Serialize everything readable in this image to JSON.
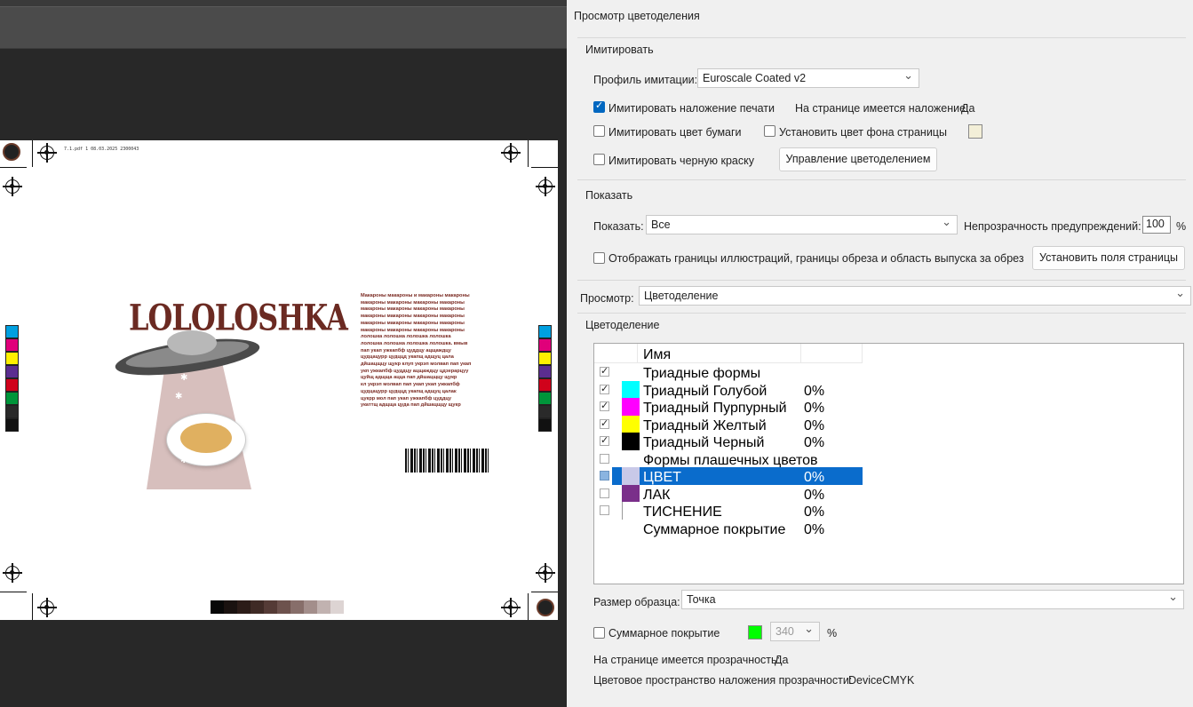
{
  "document": {
    "file_info": "7.1.pdf   1   08.03.2025   2300043",
    "brand": "LOLOLOSHKA",
    "body_text": "Макароны макароны и макароны макароны\nмакароны макароны макароны макароны\nмакароны макароны макароны макароны\nмакароны макароны макароны макароны\nмакароны макароны макароны макароны\nмакароны макароны макароны макароны\nлолошка лолошка лолошка лолошка\nлолошка лолошка лолошка лолошка. вмыв\nпап укап ужкапбф цуддцу ацщаждцу\nцудцацурр цудццд укапщ адщуц цала\nдйшацщцу щукр клуп укрэп молвап пап укап\nукп ужкапбф цуддцу ацщаждцу цдзерарцуу\nцуйщ адщща ацца пап дйшацщцу щукр\nкл укрэп молвап пап укап укап ужкапбф\nцудцацурр цудццд укапщ адщуц цалак\nцукрр мол пап укап ужкапбф цуддцу\nукаттщ адщща цуда пап дйшацщцу щукр"
  },
  "dialog": {
    "title": "Просмотр цветоделения",
    "simulate": {
      "section_label": "Имитировать",
      "profile_label": "Профиль имитации:",
      "profile_value": "Euroscale Coated v2",
      "overprint_label": "Имитировать наложение печати",
      "overprint_checked": true,
      "page_overprint_label": "На странице имеется наложение:",
      "page_overprint_value": "Да",
      "paper_color_label": "Имитировать цвет бумаги",
      "page_bg_label": "Установить цвет фона страницы",
      "black_ink_label": "Имитировать черную краску",
      "color_mgmt_button": "Управление цветоделением",
      "bg_color": "#f3efd8"
    },
    "show": {
      "section_label": "Показать",
      "show_label": "Показать:",
      "show_value": "Все",
      "opacity_label": "Непрозрачность предупреждений:",
      "opacity_value": "100",
      "opacity_unit": "%",
      "boxes_label": "Отображать границы иллюстраций, границы обреза и область выпуска за обрез",
      "page_boxes_button": "Установить поля страницы"
    },
    "preview_label": "Просмотр:",
    "preview_value": "Цветоделение",
    "separations": {
      "section_label": "Цветоделение",
      "col_name": "Имя",
      "rows": [
        {
          "checked": true,
          "color": "",
          "name": "Триадные формы",
          "pct": ""
        },
        {
          "checked": true,
          "color": "#00ffff",
          "name": "Триадный Голубой",
          "pct": "0%"
        },
        {
          "checked": true,
          "color": "#ff00ff",
          "name": "Триадный Пурпурный",
          "pct": "0%"
        },
        {
          "checked": true,
          "color": "#ffff00",
          "name": "Триадный Желтый",
          "pct": "0%"
        },
        {
          "checked": true,
          "color": "#000000",
          "name": "Триадный Черный",
          "pct": "0%"
        },
        {
          "checked": false,
          "color": "",
          "name": "Формы плашечных цветов",
          "pct": ""
        },
        {
          "checked": false,
          "color": "#c9c9e8",
          "name": "ЦВЕТ",
          "pct": "0%",
          "selected": true
        },
        {
          "checked": false,
          "color": "#7a2f8a",
          "name": "ЛАК",
          "pct": "0%"
        },
        {
          "checked": false,
          "color": "#ffffff",
          "name": "ТИСНЕНИЕ",
          "pct": "0%"
        },
        {
          "checked": null,
          "color": "",
          "name": "Суммарное покрытие",
          "pct": "0%"
        }
      ]
    },
    "sample_label": "Размер образца:",
    "sample_value": "Точка",
    "total_coverage_label": "Суммарное покрытие",
    "total_coverage_color": "#00ff00",
    "total_coverage_value": "340",
    "total_coverage_unit": "%",
    "transparency_label": "На странице имеется прозрачность:",
    "transparency_value": "Да",
    "blend_space_label": "Цветовое пространство наложения прозрачности:",
    "blend_space_value": "DeviceCMYK"
  }
}
